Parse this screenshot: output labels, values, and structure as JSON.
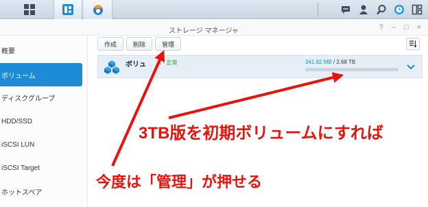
{
  "window": {
    "title": "ストレージ マネージャ",
    "controls": [
      "?",
      "–",
      "□",
      "×"
    ]
  },
  "sidebar": {
    "items": [
      {
        "label": "概要",
        "active": false
      },
      {
        "label": "ボリューム",
        "active": true
      },
      {
        "label": "ディスクグループ",
        "active": false
      },
      {
        "label": "HDD/SSD",
        "active": false
      },
      {
        "label": "iSCSI LUN",
        "active": false
      },
      {
        "label": "iSCSI Target",
        "active": false
      },
      {
        "label": "ホットスペア",
        "active": false
      }
    ]
  },
  "toolbar": {
    "create_label": "作成",
    "delete_label": "削除",
    "manage_label": "管理"
  },
  "volume": {
    "name": "ボリュ",
    "status": "1 - 正常",
    "used": "341.82 MB",
    "separator": " / ",
    "total": "2.68 TB",
    "usage_fraction": 0.0
  },
  "annotations": {
    "text1": "3TB版を初期ボリュームにすれば",
    "text2": "今度は「管理」が押せる"
  },
  "colors": {
    "accent": "#1d8bd6",
    "annotation": "#e8130c",
    "status_ok": "#3a9a3a"
  },
  "icons": [
    "grid-icon",
    "storage-manager-icon",
    "app-icon",
    "chat-icon",
    "user-icon",
    "search-icon",
    "clock-icon",
    "widgets-icon",
    "volume-cube-icon",
    "chevron-down-icon",
    "sort-icon"
  ]
}
